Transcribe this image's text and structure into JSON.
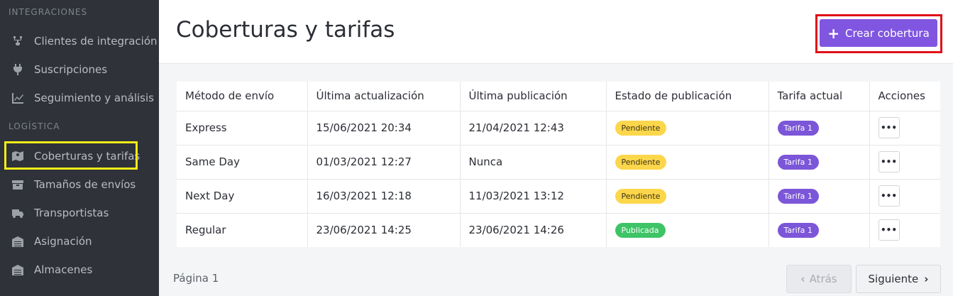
{
  "sidebar": {
    "sections": [
      {
        "title": "INTEGRACIONES"
      },
      {
        "title": "LOGÍSTICA"
      }
    ],
    "items": [
      {
        "label": "Clientes de integración",
        "icon": "plug-network-icon"
      },
      {
        "label": "Suscripciones",
        "icon": "plug-icon"
      },
      {
        "label": "Seguimiento y análisis",
        "icon": "chart-line-icon"
      },
      {
        "label": "Coberturas y tarifas",
        "icon": "map-icon",
        "active": true
      },
      {
        "label": "Tamaños de envíos",
        "icon": "box-icon"
      },
      {
        "label": "Transportistas",
        "icon": "truck-icon"
      },
      {
        "label": "Asignación",
        "icon": "warehouse-icon"
      },
      {
        "label": "Almacenes",
        "icon": "warehouse-icon"
      }
    ]
  },
  "header": {
    "title": "Coberturas y tarifas",
    "create_label": "Crear cobertura"
  },
  "table": {
    "columns": [
      "Método de envío",
      "Última actualización",
      "Última publicación",
      "Estado de publicación",
      "Tarifa actual",
      "Acciones"
    ],
    "rows": [
      {
        "method": "Express",
        "updated": "15/06/2021 20:34",
        "published": "21/04/2021 12:43",
        "status": "Pendiente",
        "status_type": "pending",
        "tariff": "Tarifa 1"
      },
      {
        "method": "Same Day",
        "updated": "01/03/2021 12:27",
        "published": "Nunca",
        "status": "Pendiente",
        "status_type": "pending",
        "tariff": "Tarifa 1"
      },
      {
        "method": "Next Day",
        "updated": "16/03/2021 12:18",
        "published": "11/03/2021 13:12",
        "status": "Pendiente",
        "status_type": "pending",
        "tariff": "Tarifa 1"
      },
      {
        "method": "Regular",
        "updated": "23/06/2021 14:25",
        "published": "23/06/2021 14:26",
        "status": "Publicada",
        "status_type": "published",
        "tariff": "Tarifa 1"
      }
    ]
  },
  "pagination": {
    "page_label": "Página 1",
    "prev_label": "Atrás",
    "next_label": "Siguiente"
  },
  "colors": {
    "accent": "#8056e0",
    "pending": "#fcd64b",
    "published": "#3ec467",
    "sidebar_bg": "#2f3239"
  }
}
